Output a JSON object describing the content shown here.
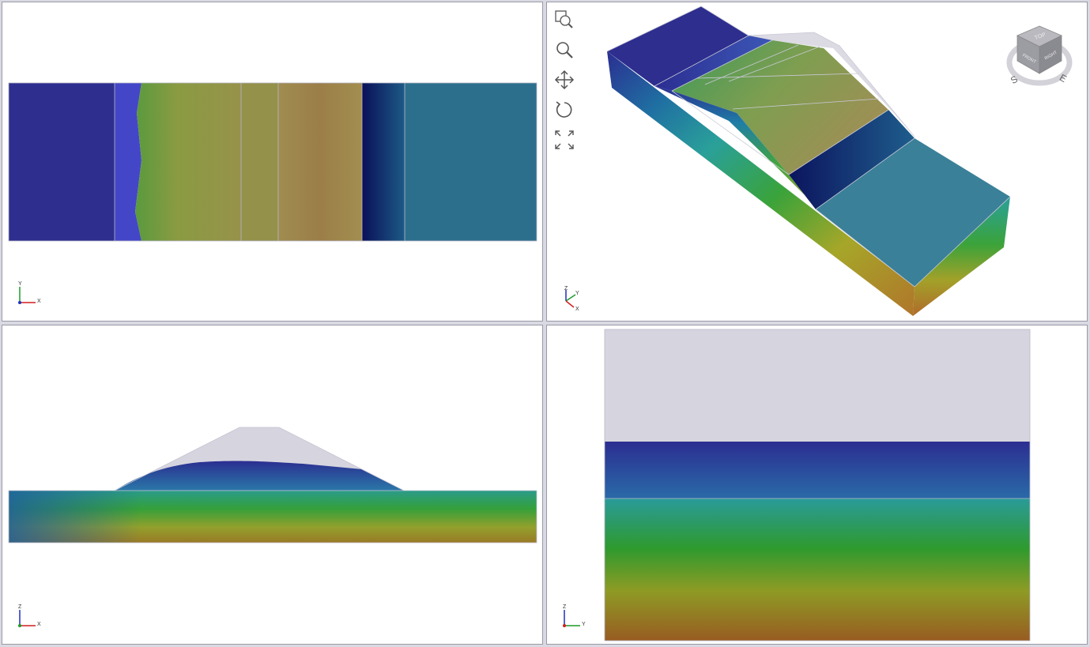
{
  "viewports": [
    {
      "id": "top",
      "view": "plan",
      "axes": {
        "horizontal": "X",
        "vertical": "Y"
      }
    },
    {
      "id": "3d",
      "view": "isometric",
      "axes": {
        "a": "Z",
        "b": "Y",
        "c": "X"
      }
    },
    {
      "id": "front",
      "view": "elevation",
      "axes": {
        "horizontal": "X",
        "vertical": "Z"
      }
    },
    {
      "id": "side",
      "view": "profile",
      "axes": {
        "horizontal": "Y",
        "vertical": "Z"
      }
    }
  ],
  "toolbar": {
    "tools": [
      {
        "name": "zoom-window",
        "icon": "zoom-window-icon"
      },
      {
        "name": "zoom",
        "icon": "magnifier-icon"
      },
      {
        "name": "pan",
        "icon": "move-arrows-icon"
      },
      {
        "name": "rotate",
        "icon": "rotate-icon"
      },
      {
        "name": "zoom-extents",
        "icon": "fit-extents-icon"
      }
    ]
  },
  "navcube": {
    "faces": {
      "top": "TOP",
      "front": "FRONT",
      "right": "RIGHT"
    },
    "compass": {
      "south": "S",
      "east": "E"
    }
  },
  "colors": {
    "background": "#d9d9e3",
    "viewport_border": "#9a9aa6",
    "gradient": [
      "#2b2e91",
      "#1f6fa2",
      "#2aa09a",
      "#2e9a2e",
      "#8e9b24",
      "#9a7a26",
      "#985c22"
    ],
    "dam_outline": "#d6d4de",
    "downstream_face": "#2c6f8d"
  }
}
